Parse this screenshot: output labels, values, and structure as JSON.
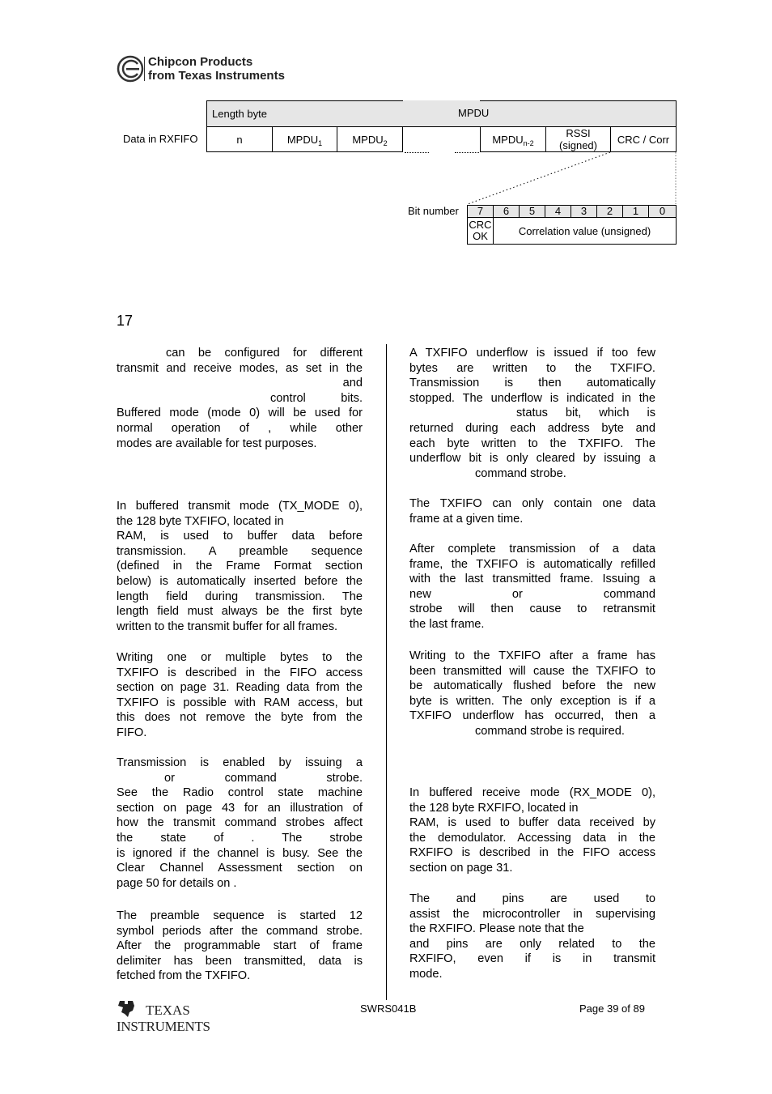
{
  "header": {
    "logo_icon": "chipcon-logo-icon",
    "logo_line1": "Chipcon Products",
    "logo_line2": "from Texas Instruments"
  },
  "diagram": {
    "row_label": "Data in RXFIFO",
    "header_row": {
      "length_byte": "Length byte",
      "mpdu": "MPDU"
    },
    "data_row": {
      "n": "n",
      "mpdu_base": "MPDU",
      "mpdu1_sub": "1",
      "mpdu2_sub": "2",
      "mpdun2_sub": "n-2",
      "rssi_line1": "RSSI",
      "rssi_line2": "(signed)",
      "crc_corr": "CRC / Corr"
    },
    "bit_number_label": "Bit number",
    "bits": [
      "7",
      "6",
      "5",
      "4",
      "3",
      "2",
      "1",
      "0"
    ],
    "crc_ok_line1": "CRC",
    "crc_ok_line2": "OK",
    "correlation": "Correlation value (unsigned)"
  },
  "section_number": "17",
  "left_column": {
    "p1": [
      "can be configured for different",
      "transmit and receive modes, as set in the",
      "and",
      "control bits.",
      "Buffered mode (mode 0) will be used for",
      "normal operation of , while other",
      "modes are available for test purposes."
    ],
    "p2": [
      "In buffered transmit mode (TX_MODE 0),",
      "the 128 byte TXFIFO, located in",
      "RAM, is used to buffer data before",
      "transmission. A preamble sequence",
      "(defined in the Frame Format section",
      "below) is automatically inserted before the",
      "length field during transmission. The",
      "length field must always be the first byte",
      "written to the transmit buffer for all frames."
    ],
    "p3": [
      "Writing one or multiple bytes to the",
      "TXFIFO is described in the FIFO access",
      "section on page 31. Reading data from the",
      "TXFIFO is possible with RAM access, but",
      "this does not remove the byte from the",
      "FIFO."
    ],
    "p4": [
      "Transmission is enabled by issuing a",
      "or command strobe.",
      "See the Radio control state machine",
      "section on page 43 for an illustration of",
      "how the transmit command strobes affect",
      "the state of . The strobe",
      "is ignored if the channel is busy. See the",
      "Clear Channel Assessment section on",
      "page 50 for details on ."
    ],
    "p5": [
      "The preamble sequence is started 12",
      "symbol periods after the command strobe.",
      "After the programmable start of frame",
      "delimiter has been transmitted, data is",
      "fetched from the TXFIFO."
    ]
  },
  "right_column": {
    "p1": [
      "A TXFIFO underflow is issued if too few",
      "bytes are written to the TXFIFO.",
      "Transmission is then automatically",
      "stopped. The underflow is indicated in the",
      "status bit, which is",
      "returned during each address byte and",
      "each byte written to the TXFIFO. The",
      "underflow bit is only cleared by issuing a",
      "command strobe."
    ],
    "p2": [
      "The TXFIFO can only contain one data",
      "frame at a given time."
    ],
    "p3": [
      "After complete transmission of a data",
      "frame, the TXFIFO is automatically refilled",
      "with the last transmitted frame. Issuing a",
      "new or command",
      "strobe will then cause to retransmit",
      "the last frame."
    ],
    "p4": [
      "Writing to the TXFIFO after a frame has",
      "been transmitted will cause the TXFIFO to",
      "be automatically flushed before the new",
      "byte is written. The only exception is if a",
      "TXFIFO underflow has occurred, then a",
      "command strobe is required."
    ],
    "p5": [
      "In buffered receive mode (RX_MODE 0),",
      "the 128 byte RXFIFO, located in",
      "RAM, is used to buffer data received by",
      "the demodulator. Accessing data in the",
      "RXFIFO is described in the FIFO access",
      "section on page 31."
    ],
    "p6": [
      "The and pins are used to",
      "assist the microcontroller in supervising",
      "the RXFIFO. Please note that the",
      "and pins are only related to the",
      "RXFIFO, even if is in transmit",
      "mode."
    ]
  },
  "footer": {
    "ti_logo_icon": "texas-instruments-logo-icon",
    "ti_line1": "Texas",
    "ti_line2": "Instruments",
    "doc_id": "SWRS041B",
    "page": "Page 39 of 89"
  }
}
